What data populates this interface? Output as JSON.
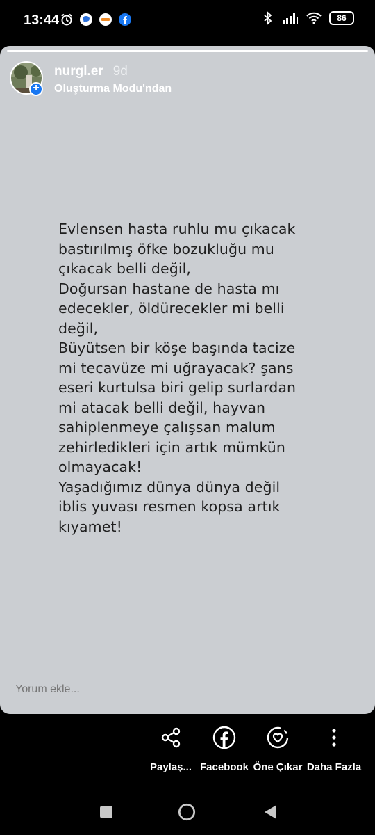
{
  "status_bar": {
    "time": "13:44",
    "battery": "86",
    "icons": [
      "alarm-icon",
      "chat-bubble-icon",
      "app-badge-icon",
      "facebook-icon",
      "bluetooth-icon",
      "signal-icon",
      "wifi-icon",
      "battery-icon"
    ]
  },
  "story": {
    "progress": 1.0,
    "username": "nurgl.er",
    "time_ago": "9d",
    "subtitle": "Oluşturma Modu'ndan",
    "text": "Evlensen hasta ruhlu mu çıkacak\nbastırılmış öfke bozukluğu mu\nçıkacak belli değil,\nDoğursan hastane de hasta mı\nedecekler, öldürecekler mi belli\ndeğil,\nBüyütsen bir köşe başında tacize\nmi tecavüze mi uğrayacak? şans\neseri kurtulsa biri gelip surlardan\nmi atacak belli değil, hayvan\nsahiplenmeye çalışsan malum\nzehirledikleri için artık mümkün\nolmayacak!\nYaşadığımız dünya dünya değil\niblis yuvası resmen kopsa artık\nkıyamet!",
    "background_color": "#cbced2",
    "text_color": "#1f1f1f"
  },
  "comment": {
    "placeholder": "Yorum ekle..."
  },
  "actions": [
    {
      "label": "Paylaş...",
      "icon": "share-icon"
    },
    {
      "label": "Facebook",
      "icon": "facebook-icon"
    },
    {
      "label": "Öne Çıkar",
      "icon": "highlight-heart-icon"
    },
    {
      "label": "Daha Fazla",
      "icon": "more-vertical-icon"
    }
  ],
  "navigation": [
    "recents-square-icon",
    "home-circle-icon",
    "back-triangle-icon"
  ]
}
